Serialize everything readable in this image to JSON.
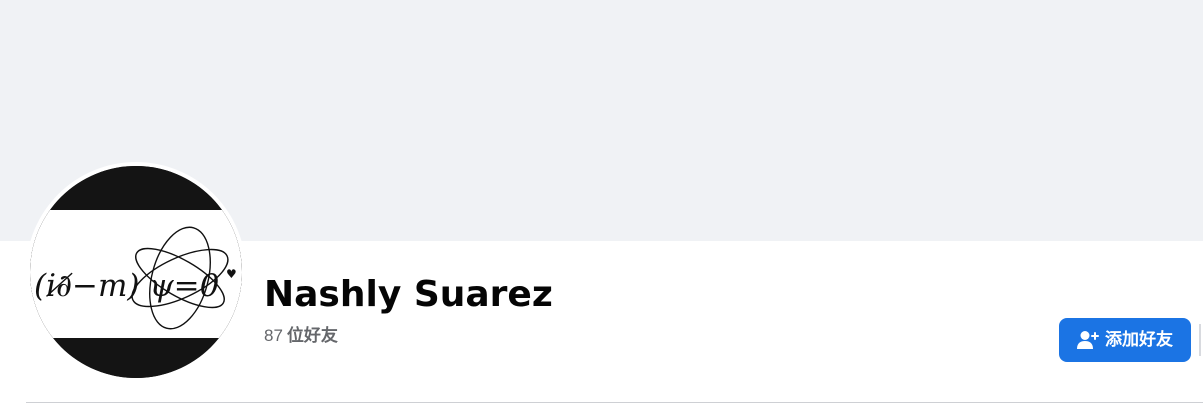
{
  "profile": {
    "name": "Nashly Suarez",
    "friend_count": "87",
    "friend_label": "位好友",
    "avatar_text": "(i∂̸−m) ψ=0"
  },
  "actions": {
    "add_friend_label": "添加好友"
  },
  "icons": {
    "add_friend": "person-plus-icon"
  },
  "colors": {
    "cover": "#f0f2f5",
    "primary_button": "#1b74e4",
    "name_text": "#050505",
    "secondary_text": "#65676b"
  }
}
